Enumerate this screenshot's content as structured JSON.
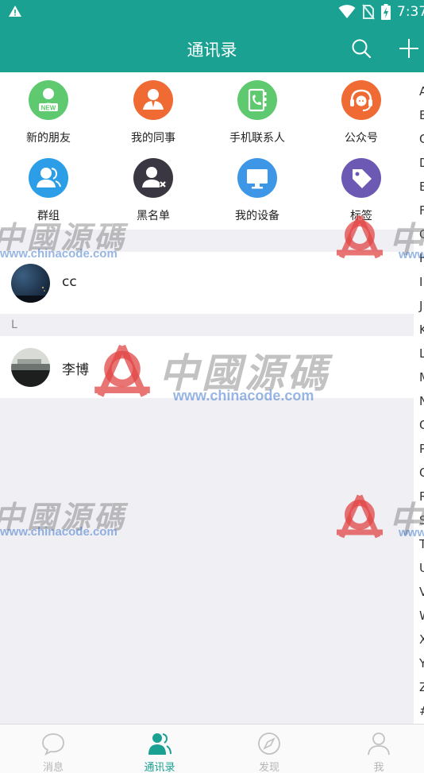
{
  "status_bar": {
    "time": "7:37"
  },
  "header": {
    "title": "通讯录"
  },
  "functions": [
    {
      "label": "新的朋友",
      "icon": "new-friend-icon",
      "color": "#5ec96e"
    },
    {
      "label": "我的同事",
      "icon": "colleague-icon",
      "color": "#f06a34"
    },
    {
      "label": "手机联系人",
      "icon": "phone-contacts-icon",
      "color": "#5ec96e"
    },
    {
      "label": "公众号",
      "icon": "headset-icon",
      "color": "#f06a34"
    },
    {
      "label": "群组",
      "icon": "group-icon",
      "color": "#2c9ee8"
    },
    {
      "label": "黑名单",
      "icon": "blacklist-icon",
      "color": "#3a3642"
    },
    {
      "label": "我的设备",
      "icon": "monitor-icon",
      "color": "#3e97e6"
    },
    {
      "label": "标签",
      "icon": "tag-icon",
      "color": "#6b59b3"
    }
  ],
  "contacts": {
    "first_name": "cc",
    "section_letter": "L",
    "second_name": "李博"
  },
  "index_letters": [
    "A",
    "B",
    "C",
    "D",
    "E",
    "F",
    "G",
    "H",
    "I",
    "J",
    "K",
    "L",
    "M",
    "N",
    "O",
    "P",
    "Q",
    "R",
    "S",
    "T",
    "U",
    "V",
    "W",
    "X",
    "Y",
    "Z",
    "#"
  ],
  "watermark": {
    "cn": "中國源碼",
    "url": "www.chinacode.com"
  },
  "bottom_nav": [
    {
      "label": "消息",
      "icon": "chat-bubble-icon",
      "active": false
    },
    {
      "label": "通讯录",
      "icon": "contacts-icon",
      "active": true
    },
    {
      "label": "发现",
      "icon": "compass-icon",
      "active": false
    },
    {
      "label": "我",
      "icon": "person-icon",
      "active": false
    }
  ],
  "colors": {
    "primary": "#1aa192",
    "background": "#efeff4",
    "nav_inactive": "#b5b5b5"
  }
}
